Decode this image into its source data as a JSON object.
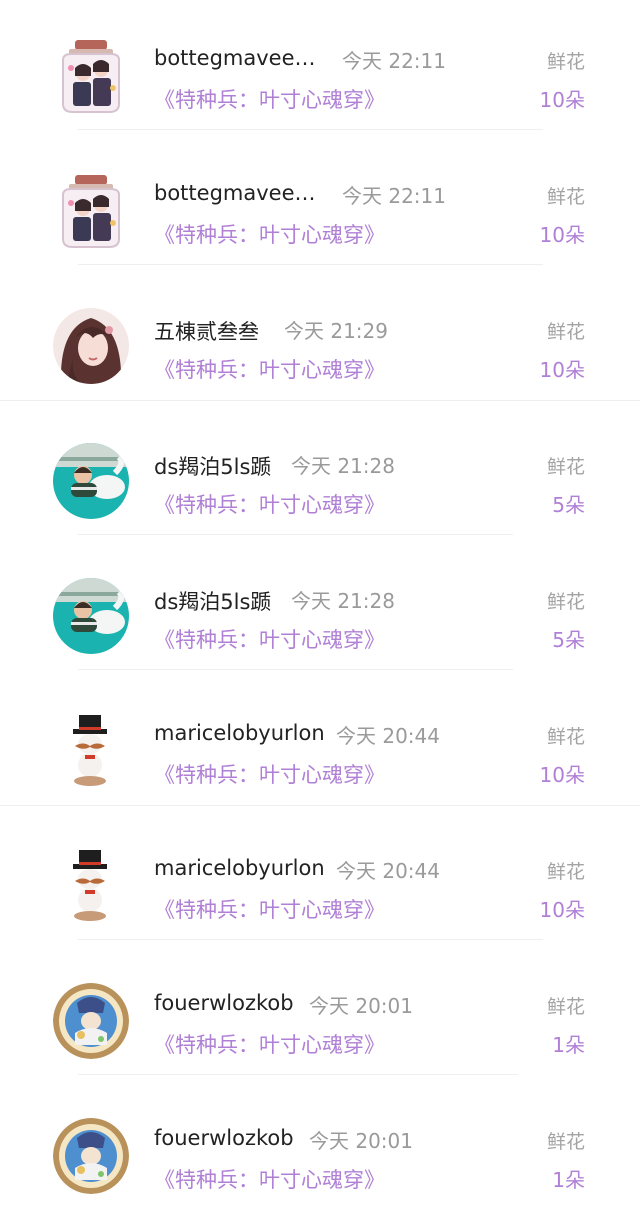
{
  "gifts": [
    {
      "user": "bottegmavee…",
      "time": "今天 22:11",
      "book": "《特种兵：叶寸心魂穿》",
      "gift_label": "鲜花",
      "amount": "10朵",
      "avatar": "jar-avatar-icon"
    },
    {
      "user": "bottegmavee…",
      "time": "今天 22:11",
      "book": "《特种兵：叶寸心魂穿》",
      "gift_label": "鲜花",
      "amount": "10朵",
      "avatar": "jar-avatar-icon"
    },
    {
      "user": "五棟贰叁叁",
      "time": "今天 21:29",
      "book": "《特种兵：叶寸心魂穿》",
      "gift_label": "鲜花",
      "amount": "10朵",
      "avatar": "girl-avatar-icon"
    },
    {
      "user": "ds羯泊5ls踬",
      "time": "今天 21:28",
      "book": "《特种兵：叶寸心魂穿》",
      "gift_label": "鲜花",
      "amount": "5朵",
      "avatar": "child-pool-avatar-icon"
    },
    {
      "user": "ds羯泊5ls踬",
      "time": "今天 21:28",
      "book": "《特种兵：叶寸心魂穿》",
      "gift_label": "鲜花",
      "amount": "5朵",
      "avatar": "child-pool-avatar-icon"
    },
    {
      "user": "maricelobyurlon",
      "time": "今天 20:44",
      "book": "《特种兵：叶寸心魂穿》",
      "gift_label": "鲜花",
      "amount": "10朵",
      "avatar": "snowman-avatar-icon"
    },
    {
      "user": "maricelobyurlon",
      "time": "今天 20:44",
      "book": "《特种兵：叶寸心魂穿》",
      "gift_label": "鲜花",
      "amount": "10朵",
      "avatar": "snowman-avatar-icon"
    },
    {
      "user": "fouerwlozkob",
      "time": "今天 20:01",
      "book": "《特种兵：叶寸心魂穿》",
      "gift_label": "鲜花",
      "amount": "1朵",
      "avatar": "badge-avatar-icon"
    },
    {
      "user": "fouerwlozkob",
      "time": "今天 20:01",
      "book": "《特种兵：叶寸心魂穿》",
      "gift_label": "鲜花",
      "amount": "1朵",
      "avatar": "badge-avatar-icon"
    }
  ],
  "colors": {
    "accent": "#b07fd6",
    "name": "#222222",
    "muted": "#9a9a9a",
    "divider": "#efefef"
  }
}
